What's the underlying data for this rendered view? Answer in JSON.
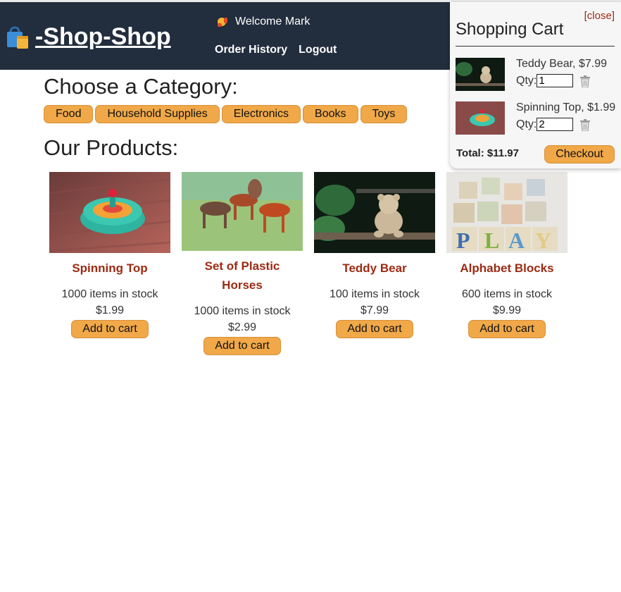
{
  "header": {
    "logo_text": "-Shop-Shop",
    "welcome_text": "Welcome Mark",
    "nav": {
      "order_history": "Order History",
      "logout": "Logout"
    }
  },
  "categories": {
    "title": "Choose a Category:",
    "items": [
      "Food",
      "Household Supplies",
      "Electronics",
      "Books",
      "Toys"
    ]
  },
  "products": {
    "title": "Our Products:",
    "add_label": "Add to cart",
    "items": [
      {
        "name": "Spinning Top",
        "stock": "1000 items in stock",
        "price": "$1.99",
        "image": "spinning-top"
      },
      {
        "name": "Set of Plastic Horses",
        "stock": "1000 items in stock",
        "price": "$2.99",
        "image": "plastic-horses"
      },
      {
        "name": "Teddy Bear",
        "stock": "100 items in stock",
        "price": "$7.99",
        "image": "teddy-bear"
      },
      {
        "name": "Alphabet Blocks",
        "stock": "600 items in stock",
        "price": "$9.99",
        "image": "alphabet-blocks"
      }
    ]
  },
  "cart": {
    "close_label": "[close]",
    "title": "Shopping Cart",
    "qty_label": "Qty:",
    "items": [
      {
        "name": "Teddy Bear, $7.99",
        "qty": "1",
        "image": "teddy-bear"
      },
      {
        "name": "Spinning Top, $1.99",
        "qty": "2",
        "image": "spinning-top"
      }
    ],
    "total": "Total: $11.97",
    "checkout_label": "Checkout"
  },
  "colors": {
    "nav_bg": "#222d3d",
    "accent_button": "#f0a848",
    "product_name": "#9c2a12"
  }
}
